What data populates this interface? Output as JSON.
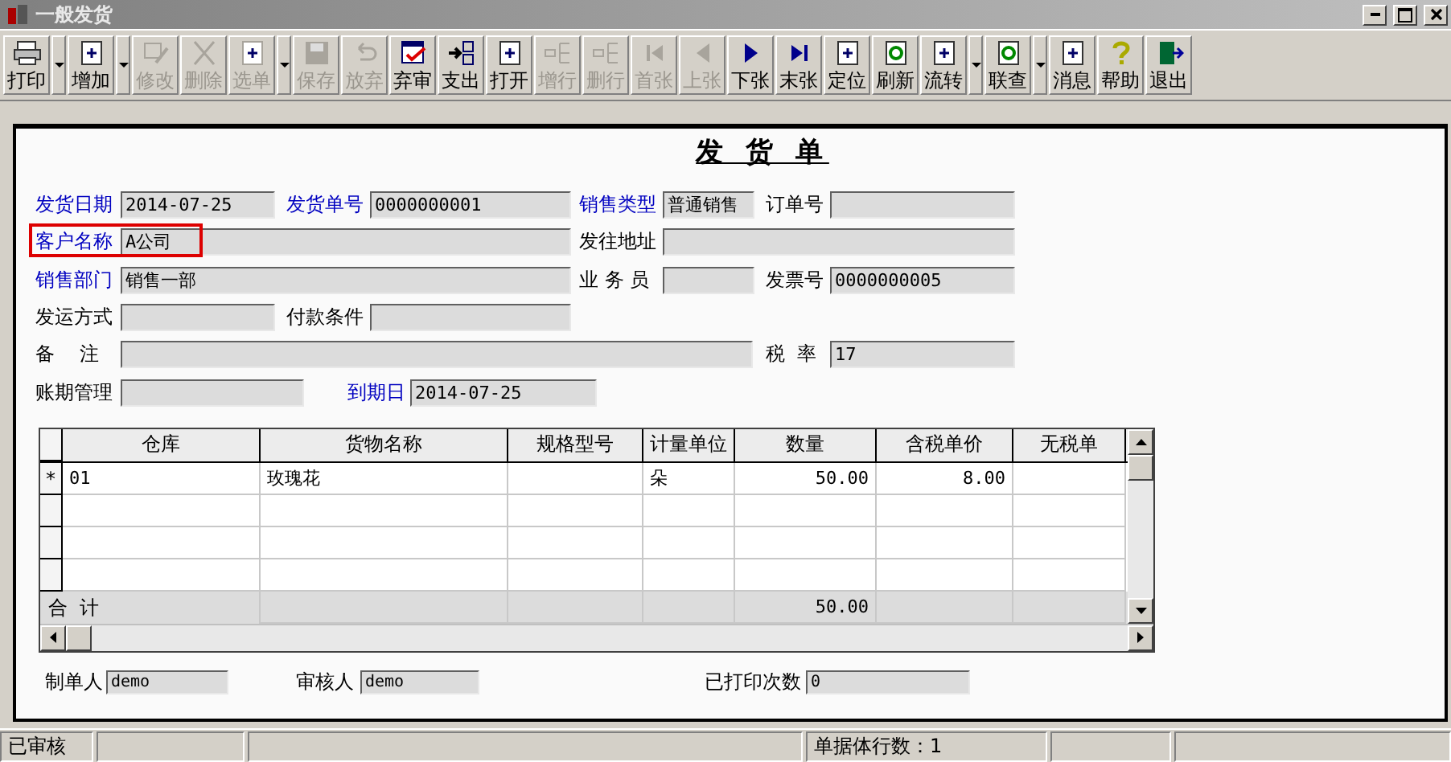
{
  "window": {
    "title": "一般发货"
  },
  "toolbar": [
    {
      "label": "打印",
      "disabled": false,
      "dropdown": true
    },
    {
      "label": "增加",
      "disabled": false,
      "dropdown": true
    },
    {
      "label": "修改",
      "disabled": true,
      "dropdown": false
    },
    {
      "label": "删除",
      "disabled": true,
      "dropdown": false
    },
    {
      "label": "选单",
      "disabled": true,
      "dropdown": true
    },
    {
      "label": "保存",
      "disabled": true,
      "dropdown": false
    },
    {
      "label": "放弃",
      "disabled": true,
      "dropdown": false
    },
    {
      "label": "弃审",
      "disabled": false,
      "dropdown": false
    },
    {
      "label": "支出",
      "disabled": false,
      "dropdown": false
    },
    {
      "label": "打开",
      "disabled": false,
      "dropdown": false
    },
    {
      "label": "增行",
      "disabled": true,
      "dropdown": false
    },
    {
      "label": "删行",
      "disabled": true,
      "dropdown": false
    },
    {
      "label": "首张",
      "disabled": true,
      "dropdown": false
    },
    {
      "label": "上张",
      "disabled": true,
      "dropdown": false
    },
    {
      "label": "下张",
      "disabled": false,
      "dropdown": false
    },
    {
      "label": "末张",
      "disabled": false,
      "dropdown": false
    },
    {
      "label": "定位",
      "disabled": false,
      "dropdown": false
    },
    {
      "label": "刷新",
      "disabled": false,
      "dropdown": false
    },
    {
      "label": "流转",
      "disabled": false,
      "dropdown": true
    },
    {
      "label": "联查",
      "disabled": false,
      "dropdown": true
    },
    {
      "label": "消息",
      "disabled": false,
      "dropdown": false
    },
    {
      "label": "帮助",
      "disabled": false,
      "dropdown": false
    },
    {
      "label": "退出",
      "disabled": false,
      "dropdown": false
    }
  ],
  "form": {
    "title": "发 货 单",
    "fields": [
      {
        "label": "发货日期",
        "value": "2014-07-25",
        "color": "#0000c0",
        "marked": false
      },
      {
        "label": "发货单号",
        "value": "0000000001",
        "color": "#0000c0",
        "marked": false
      },
      {
        "label": "销售类型",
        "value": "普通销售",
        "color": "#0000c0",
        "marked": false
      },
      {
        "label": "订单号",
        "color": "#000000",
        "marked": false
      },
      {
        "label": "客户名称",
        "value": "A公司",
        "color": "#0000c0",
        "marked": true
      },
      {
        "label": "发往地址",
        "color": "#000000",
        "marked": false
      },
      {
        "label": "销售部门",
        "value": "销售一部",
        "color": "#0000c0",
        "marked": false
      },
      {
        "label": "业 务 员",
        "color": "#000000",
        "marked": false
      },
      {
        "label": "发票号",
        "value": "0000000005",
        "color": "#000000",
        "marked": false
      },
      {
        "label": "发运方式",
        "color": "#000000",
        "marked": false
      },
      {
        "label": "付款条件",
        "color": "#000000",
        "marked": false
      },
      {
        "label": "备    注",
        "color": "#000000",
        "marked": false
      },
      {
        "label": "税  率",
        "value": "17",
        "color": "#000000",
        "marked": false
      },
      {
        "label": "账期管理",
        "color": "#000000",
        "marked": false
      },
      {
        "label": "到期日",
        "value": "2014-07-25",
        "color": "#0000c0",
        "marked": false
      }
    ]
  },
  "table": {
    "columns": [
      "仓库",
      "货物名称",
      "规格型号",
      "计量单位",
      "数量",
      "含税单价",
      "无税单"
    ],
    "rows": [
      {
        "marker": "*",
        "cells": [
          "01",
          "玫瑰花",
          "",
          "朵",
          "50.00",
          "8.00",
          ""
        ]
      },
      {
        "cells": [
          "",
          "",
          "",
          "",
          "",
          "",
          ""
        ]
      },
      {
        "cells": [
          "",
          "",
          "",
          "",
          "",
          "",
          ""
        ]
      },
      {
        "cells": [
          "",
          "",
          "",
          "",
          "",
          "",
          ""
        ]
      }
    ],
    "total": {
      "label": "合  计",
      "cells": [
        "",
        "",
        "",
        "",
        "50.00",
        "",
        ""
      ]
    }
  },
  "footer": [
    {
      "label": "制单人",
      "value": "demo"
    },
    {
      "label": "审核人",
      "value": "demo"
    },
    {
      "label": "已打印次数",
      "value": "0"
    }
  ],
  "status_bar": [
    "已审核",
    "单据体行数：1"
  ]
}
